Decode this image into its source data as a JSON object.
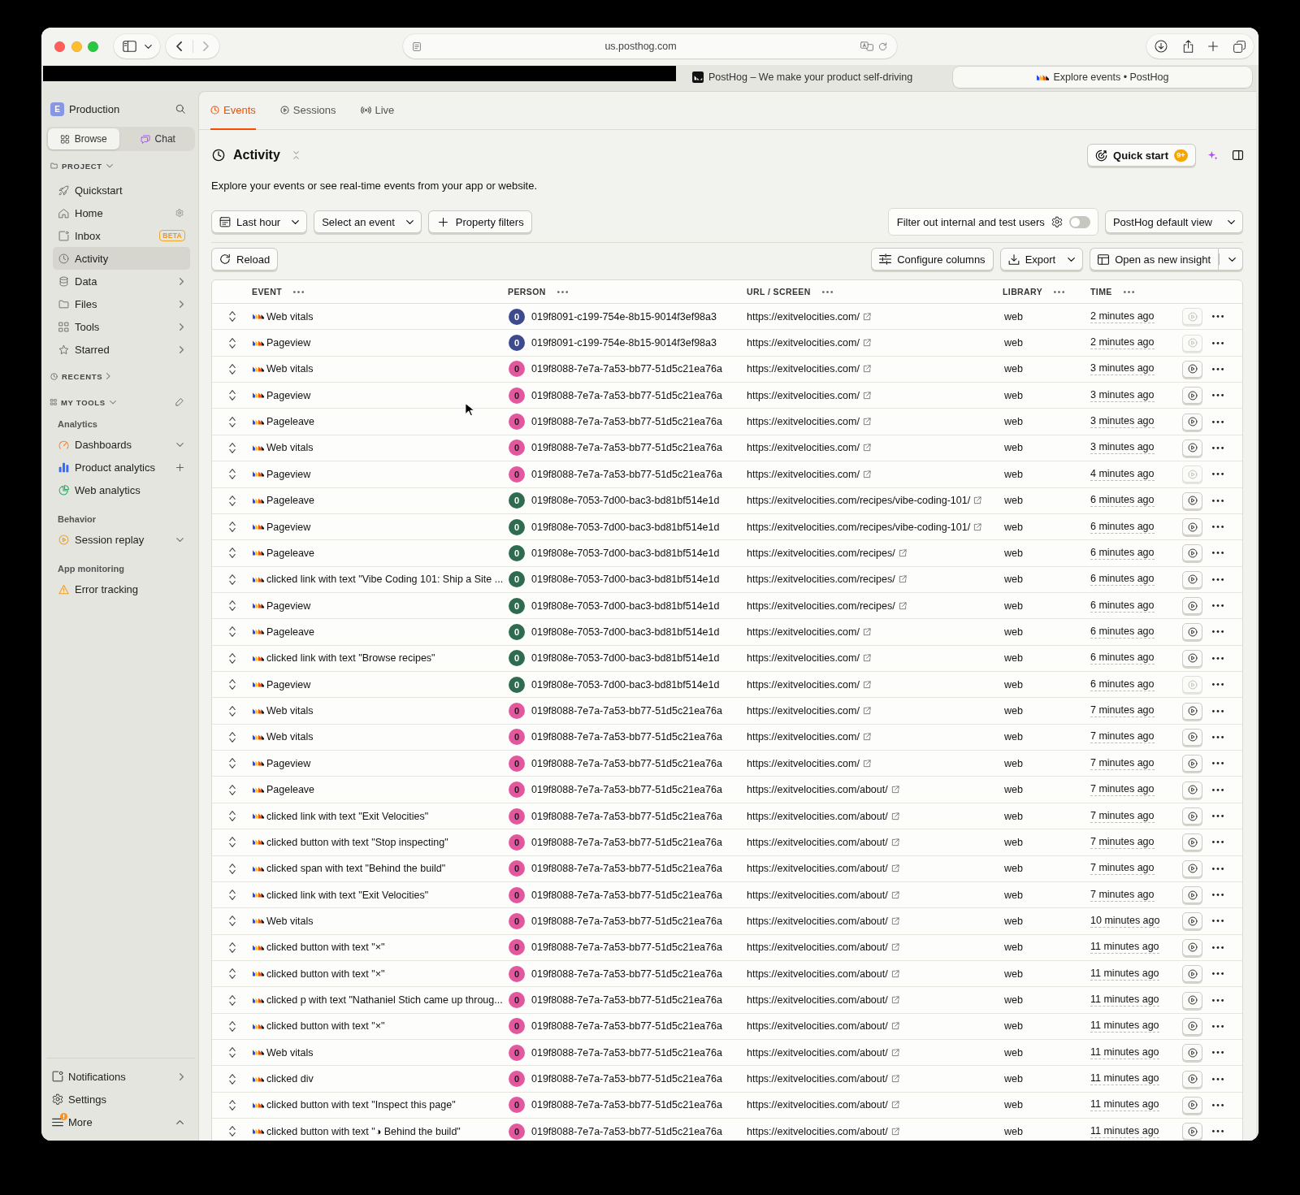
{
  "browser": {
    "url": "us.posthog.com",
    "tabs": [
      {
        "title": "PostHog – We make your product self-driving",
        "selected": false
      },
      {
        "title": "Explore events • PostHog",
        "selected": true
      }
    ]
  },
  "sidebar": {
    "workspace": {
      "initial": "E",
      "name": "Production"
    },
    "modes": [
      {
        "label": "Browse",
        "selected": true
      },
      {
        "label": "Chat",
        "selected": false
      }
    ],
    "project": {
      "title": "PROJECT",
      "expanded": true,
      "items": [
        {
          "label": "Quickstart",
          "kind": "plain",
          "selected": false
        },
        {
          "label": "Home",
          "kind": "settings",
          "selected": false
        },
        {
          "label": "Inbox",
          "kind": "badge",
          "badge": "BETA",
          "selected": false
        },
        {
          "label": "Activity",
          "kind": "plain",
          "selected": true
        },
        {
          "label": "Data",
          "kind": "submenu",
          "selected": false
        },
        {
          "label": "Files",
          "kind": "submenu",
          "selected": false
        },
        {
          "label": "Tools",
          "kind": "submenu",
          "selected": false
        },
        {
          "label": "Starred",
          "kind": "submenu",
          "selected": false
        }
      ]
    },
    "recents": {
      "title": "RECENTS",
      "expanded": false
    },
    "my_tools": {
      "title": "MY TOOLS",
      "expanded": true,
      "groups": [
        {
          "title": "Analytics",
          "items": [
            {
              "label": "Dashboards",
              "kind": "dropdown",
              "selected": false
            },
            {
              "label": "Product analytics",
              "kind": "add",
              "selected": false
            },
            {
              "label": "Web analytics",
              "kind": "plain",
              "selected": false
            }
          ]
        },
        {
          "title": "Behavior",
          "items": [
            {
              "label": "Session replay",
              "kind": "dropdown",
              "selected": false
            }
          ]
        },
        {
          "title": "App monitoring",
          "items": [
            {
              "label": "Error tracking",
              "kind": "plain",
              "selected": false
            }
          ]
        }
      ]
    },
    "footer": [
      {
        "label": "Notifications",
        "kind": "submenu",
        "alert": false
      },
      {
        "label": "Settings",
        "kind": "plain",
        "alert": false
      },
      {
        "label": "More",
        "kind": "collapse",
        "alert": true
      }
    ]
  },
  "page": {
    "tabs": [
      {
        "label": "Events",
        "selected": true
      },
      {
        "label": "Sessions",
        "selected": false
      },
      {
        "label": "Live",
        "selected": false
      }
    ],
    "title": "Activity",
    "quick_start": {
      "label": "Quick start",
      "badge": "9+"
    },
    "description": "Explore your events or see real-time events from your app or website.",
    "filters": {
      "time_range": "Last hour",
      "event": "Select an event",
      "property_filters": "Property filters",
      "test_users": {
        "label": "Filter out internal and test users",
        "on": false
      },
      "view": "PostHog default view"
    },
    "actions": {
      "reload": "Reload",
      "configure_columns": "Configure columns",
      "export": "Export",
      "open_insight": "Open as new insight"
    }
  },
  "table": {
    "columns": [
      {
        "label": "EVENT"
      },
      {
        "label": "PERSON"
      },
      {
        "label": "URL / SCREEN"
      },
      {
        "label": "LIBRARY"
      },
      {
        "label": "TIME"
      }
    ],
    "rows": [
      {
        "event": "Web vitals",
        "person": {
          "initial": "0",
          "id": "019f8091-c199-754e-8b15-9014f3ef98a3",
          "color": "#3d4b8c"
        },
        "url": "https://exitvelocities.com/",
        "library": "web",
        "time": "2 minutes ago",
        "recording": false
      },
      {
        "event": "Pageview",
        "person": {
          "initial": "0",
          "id": "019f8091-c199-754e-8b15-9014f3ef98a3",
          "color": "#3d4b8c"
        },
        "url": "https://exitvelocities.com/",
        "library": "web",
        "time": "2 minutes ago",
        "recording": false
      },
      {
        "event": "Web vitals",
        "person": {
          "initial": "0",
          "id": "019f8088-7e7a-7a53-bb77-51d5c21ea76a",
          "color": "#e2579e"
        },
        "url": "https://exitvelocities.com/",
        "library": "web",
        "time": "3 minutes ago",
        "recording": true
      },
      {
        "event": "Pageview",
        "person": {
          "initial": "0",
          "id": "019f8088-7e7a-7a53-bb77-51d5c21ea76a",
          "color": "#e2579e"
        },
        "url": "https://exitvelocities.com/",
        "library": "web",
        "time": "3 minutes ago",
        "recording": true
      },
      {
        "event": "Pageleave",
        "person": {
          "initial": "0",
          "id": "019f8088-7e7a-7a53-bb77-51d5c21ea76a",
          "color": "#e2579e"
        },
        "url": "https://exitvelocities.com/",
        "library": "web",
        "time": "3 minutes ago",
        "recording": true
      },
      {
        "event": "Web vitals",
        "person": {
          "initial": "0",
          "id": "019f8088-7e7a-7a53-bb77-51d5c21ea76a",
          "color": "#e2579e"
        },
        "url": "https://exitvelocities.com/",
        "library": "web",
        "time": "3 minutes ago",
        "recording": true
      },
      {
        "event": "Pageview",
        "person": {
          "initial": "0",
          "id": "019f8088-7e7a-7a53-bb77-51d5c21ea76a",
          "color": "#e2579e"
        },
        "url": "https://exitvelocities.com/",
        "library": "web",
        "time": "4 minutes ago",
        "recording": false
      },
      {
        "event": "Pageleave",
        "person": {
          "initial": "0",
          "id": "019f808e-7053-7d00-bac3-bd81bf514e1d",
          "color": "#2f6b4e"
        },
        "url": "https://exitvelocities.com/recipes/vibe-coding-101/",
        "library": "web",
        "time": "6 minutes ago",
        "recording": true
      },
      {
        "event": "Pageview",
        "person": {
          "initial": "0",
          "id": "019f808e-7053-7d00-bac3-bd81bf514e1d",
          "color": "#2f6b4e"
        },
        "url": "https://exitvelocities.com/recipes/vibe-coding-101/",
        "library": "web",
        "time": "6 minutes ago",
        "recording": true
      },
      {
        "event": "Pageleave",
        "person": {
          "initial": "0",
          "id": "019f808e-7053-7d00-bac3-bd81bf514e1d",
          "color": "#2f6b4e"
        },
        "url": "https://exitvelocities.com/recipes/",
        "library": "web",
        "time": "6 minutes ago",
        "recording": true
      },
      {
        "event": "clicked link with text \"Vibe Coding 101: Ship a Site ...",
        "person": {
          "initial": "0",
          "id": "019f808e-7053-7d00-bac3-bd81bf514e1d",
          "color": "#2f6b4e"
        },
        "url": "https://exitvelocities.com/recipes/",
        "library": "web",
        "time": "6 minutes ago",
        "recording": true
      },
      {
        "event": "Pageview",
        "person": {
          "initial": "0",
          "id": "019f808e-7053-7d00-bac3-bd81bf514e1d",
          "color": "#2f6b4e"
        },
        "url": "https://exitvelocities.com/recipes/",
        "library": "web",
        "time": "6 minutes ago",
        "recording": true
      },
      {
        "event": "Pageleave",
        "person": {
          "initial": "0",
          "id": "019f808e-7053-7d00-bac3-bd81bf514e1d",
          "color": "#2f6b4e"
        },
        "url": "https://exitvelocities.com/",
        "library": "web",
        "time": "6 minutes ago",
        "recording": true
      },
      {
        "event": "clicked link with text \"Browse recipes\"",
        "person": {
          "initial": "0",
          "id": "019f808e-7053-7d00-bac3-bd81bf514e1d",
          "color": "#2f6b4e"
        },
        "url": "https://exitvelocities.com/",
        "library": "web",
        "time": "6 minutes ago",
        "recording": true
      },
      {
        "event": "Pageview",
        "person": {
          "initial": "0",
          "id": "019f808e-7053-7d00-bac3-bd81bf514e1d",
          "color": "#2f6b4e"
        },
        "url": "https://exitvelocities.com/",
        "library": "web",
        "time": "6 minutes ago",
        "recording": false
      },
      {
        "event": "Web vitals",
        "person": {
          "initial": "0",
          "id": "019f8088-7e7a-7a53-bb77-51d5c21ea76a",
          "color": "#e2579e"
        },
        "url": "https://exitvelocities.com/",
        "library": "web",
        "time": "7 minutes ago",
        "recording": true
      },
      {
        "event": "Web vitals",
        "person": {
          "initial": "0",
          "id": "019f8088-7e7a-7a53-bb77-51d5c21ea76a",
          "color": "#e2579e"
        },
        "url": "https://exitvelocities.com/",
        "library": "web",
        "time": "7 minutes ago",
        "recording": true
      },
      {
        "event": "Pageview",
        "person": {
          "initial": "0",
          "id": "019f8088-7e7a-7a53-bb77-51d5c21ea76a",
          "color": "#e2579e"
        },
        "url": "https://exitvelocities.com/",
        "library": "web",
        "time": "7 minutes ago",
        "recording": true
      },
      {
        "event": "Pageleave",
        "person": {
          "initial": "0",
          "id": "019f8088-7e7a-7a53-bb77-51d5c21ea76a",
          "color": "#e2579e"
        },
        "url": "https://exitvelocities.com/about/",
        "library": "web",
        "time": "7 minutes ago",
        "recording": true
      },
      {
        "event": "clicked link with text \"Exit Velocities\"",
        "person": {
          "initial": "0",
          "id": "019f8088-7e7a-7a53-bb77-51d5c21ea76a",
          "color": "#e2579e"
        },
        "url": "https://exitvelocities.com/about/",
        "library": "web",
        "time": "7 minutes ago",
        "recording": true
      },
      {
        "event": "clicked button with text \"Stop inspecting\"",
        "person": {
          "initial": "0",
          "id": "019f8088-7e7a-7a53-bb77-51d5c21ea76a",
          "color": "#e2579e"
        },
        "url": "https://exitvelocities.com/about/",
        "library": "web",
        "time": "7 minutes ago",
        "recording": true
      },
      {
        "event": "clicked span with text \"Behind the build\"",
        "person": {
          "initial": "0",
          "id": "019f8088-7e7a-7a53-bb77-51d5c21ea76a",
          "color": "#e2579e"
        },
        "url": "https://exitvelocities.com/about/",
        "library": "web",
        "time": "7 minutes ago",
        "recording": true
      },
      {
        "event": "clicked link with text \"Exit Velocities\"",
        "person": {
          "initial": "0",
          "id": "019f8088-7e7a-7a53-bb77-51d5c21ea76a",
          "color": "#e2579e"
        },
        "url": "https://exitvelocities.com/about/",
        "library": "web",
        "time": "7 minutes ago",
        "recording": true
      },
      {
        "event": "Web vitals",
        "person": {
          "initial": "0",
          "id": "019f8088-7e7a-7a53-bb77-51d5c21ea76a",
          "color": "#e2579e"
        },
        "url": "https://exitvelocities.com/about/",
        "library": "web",
        "time": "10 minutes ago",
        "recording": true
      },
      {
        "event": "clicked button with text \"×\"",
        "person": {
          "initial": "0",
          "id": "019f8088-7e7a-7a53-bb77-51d5c21ea76a",
          "color": "#e2579e"
        },
        "url": "https://exitvelocities.com/about/",
        "library": "web",
        "time": "11 minutes ago",
        "recording": true
      },
      {
        "event": "clicked button with text \"×\"",
        "person": {
          "initial": "0",
          "id": "019f8088-7e7a-7a53-bb77-51d5c21ea76a",
          "color": "#e2579e"
        },
        "url": "https://exitvelocities.com/about/",
        "library": "web",
        "time": "11 minutes ago",
        "recording": true
      },
      {
        "event": "clicked p with text \"Nathaniel Stich came up throug...",
        "person": {
          "initial": "0",
          "id": "019f8088-7e7a-7a53-bb77-51d5c21ea76a",
          "color": "#e2579e"
        },
        "url": "https://exitvelocities.com/about/",
        "library": "web",
        "time": "11 minutes ago",
        "recording": true
      },
      {
        "event": "clicked button with text \"×\"",
        "person": {
          "initial": "0",
          "id": "019f8088-7e7a-7a53-bb77-51d5c21ea76a",
          "color": "#e2579e"
        },
        "url": "https://exitvelocities.com/about/",
        "library": "web",
        "time": "11 minutes ago",
        "recording": true
      },
      {
        "event": "Web vitals",
        "person": {
          "initial": "0",
          "id": "019f8088-7e7a-7a53-bb77-51d5c21ea76a",
          "color": "#e2579e"
        },
        "url": "https://exitvelocities.com/about/",
        "library": "web",
        "time": "11 minutes ago",
        "recording": true
      },
      {
        "event": "clicked div",
        "person": {
          "initial": "0",
          "id": "019f8088-7e7a-7a53-bb77-51d5c21ea76a",
          "color": "#e2579e"
        },
        "url": "https://exitvelocities.com/about/",
        "library": "web",
        "time": "11 minutes ago",
        "recording": true
      },
      {
        "event": "clicked button with text \"Inspect this page\"",
        "person": {
          "initial": "0",
          "id": "019f8088-7e7a-7a53-bb77-51d5c21ea76a",
          "color": "#e2579e"
        },
        "url": "https://exitvelocities.com/about/",
        "library": "web",
        "time": "11 minutes ago",
        "recording": true
      },
      {
        "event": "clicked button with text \"◑ Behind the build\"",
        "person": {
          "initial": "0",
          "id": "019f8088-7e7a-7a53-bb77-51d5c21ea76a",
          "color": "#e2579e"
        },
        "url": "https://exitvelocities.com/about/",
        "library": "web",
        "time": "11 minutes ago",
        "recording": true
      }
    ]
  }
}
